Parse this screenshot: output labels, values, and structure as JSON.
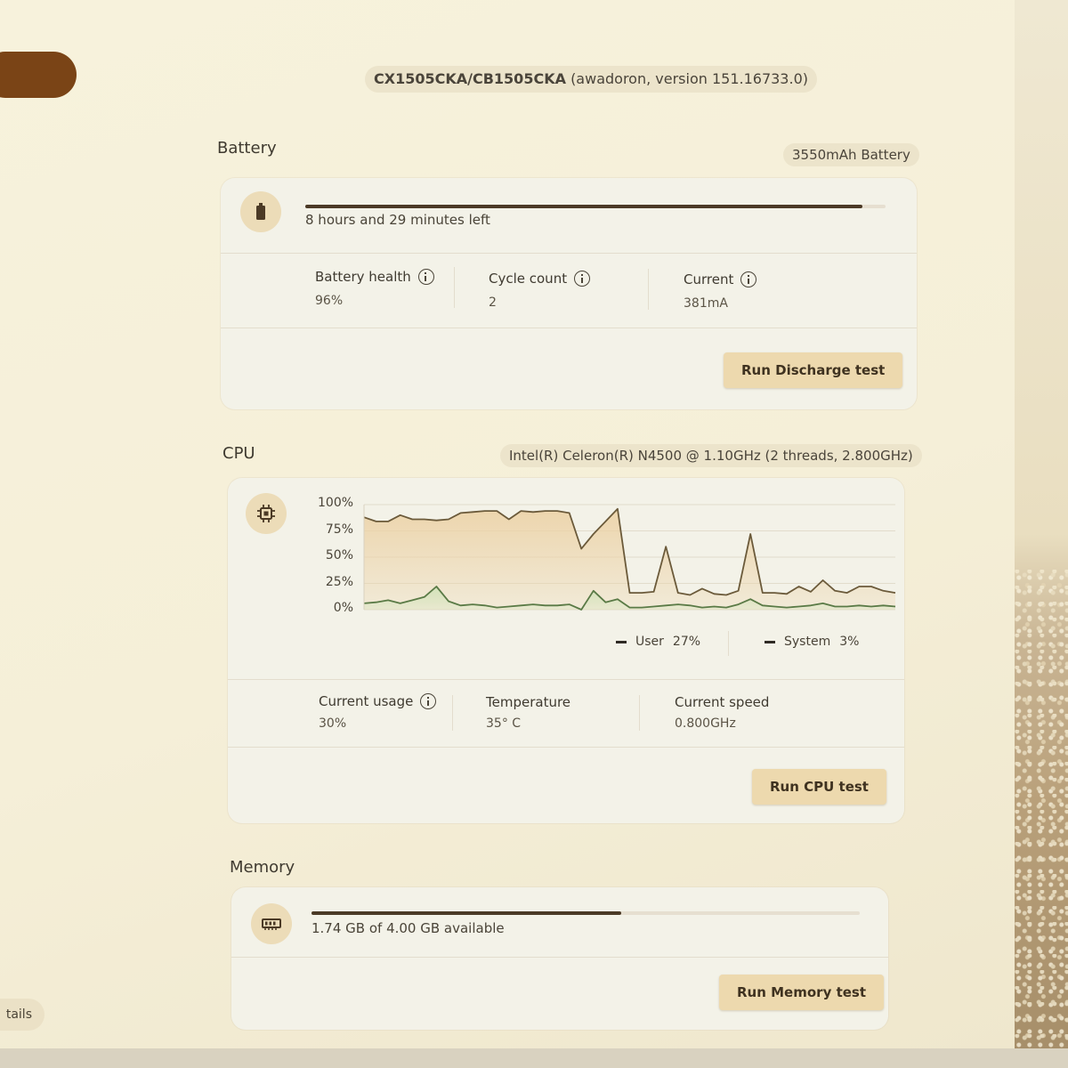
{
  "device": {
    "model": "CX1505CKA/CB1505CKA",
    "board_version": "(awadoron, version 151.16733.0)"
  },
  "side": {
    "bottom_pill_text": "tails"
  },
  "battery": {
    "title": "Battery",
    "capacity_chip": "3550mAh Battery",
    "charge_fraction": 0.96,
    "time_left": "8 hours and 29 minutes left",
    "metrics": [
      {
        "label": "Battery health",
        "value": "96%",
        "info": true
      },
      {
        "label": "Cycle count",
        "value": "2",
        "info": true
      },
      {
        "label": "Current",
        "value": "381mA",
        "info": true
      }
    ],
    "button": "Run Discharge test"
  },
  "cpu": {
    "title": "CPU",
    "model_chip": "Intel(R) Celeron(R) N4500 @ 1.10GHz (2 threads, 2.800GHz)",
    "legend": [
      {
        "name": "User",
        "value": "27%"
      },
      {
        "name": "System",
        "value": "3%"
      }
    ],
    "metrics": [
      {
        "label": "Current usage",
        "value": "30%",
        "info": true
      },
      {
        "label": "Temperature",
        "value": "35° C",
        "info": false
      },
      {
        "label": "Current speed",
        "value": "0.800GHz",
        "info": false
      }
    ],
    "button": "Run CPU test"
  },
  "chart_data": {
    "type": "area",
    "title": "",
    "xlabel": "",
    "ylabel": "",
    "ylim": [
      0,
      100
    ],
    "y_ticks": [
      "100%",
      "75%",
      "50%",
      "25%",
      "0%"
    ],
    "grid": true,
    "series": [
      {
        "name": "User",
        "color": "#6b5a3a",
        "fill": "#ecd2a6",
        "values": [
          88,
          84,
          84,
          90,
          86,
          86,
          85,
          86,
          92,
          93,
          94,
          94,
          86,
          94,
          93,
          94,
          94,
          92,
          58,
          72,
          84,
          96,
          16,
          16,
          17,
          60,
          16,
          14,
          20,
          15,
          14,
          18,
          72,
          16,
          16,
          15,
          22,
          17,
          28,
          18,
          16,
          22,
          22,
          18,
          16
        ]
      },
      {
        "name": "System",
        "color": "#5a7a46",
        "fill": "#cfe3b8",
        "values": [
          6,
          7,
          9,
          6,
          9,
          12,
          22,
          8,
          4,
          5,
          4,
          2,
          3,
          4,
          5,
          4,
          4,
          5,
          0,
          18,
          7,
          10,
          2,
          2,
          3,
          4,
          5,
          4,
          2,
          3,
          2,
          5,
          10,
          4,
          3,
          2,
          3,
          4,
          6,
          3,
          3,
          4,
          3,
          4,
          3
        ]
      }
    ]
  },
  "memory": {
    "title": "Memory",
    "available_text": "1.74 GB of 4.00 GB available",
    "used_fraction": 0.565,
    "button": "Run Memory test"
  },
  "icons": {
    "battery": "battery-icon",
    "cpu": "cpu-chip-icon",
    "memory": "memory-module-icon",
    "info": "info-icon"
  },
  "colors": {
    "accent_button": "#edd9ae",
    "icon_bg": "#ecdcb8",
    "bar_fill": "#4b3a26",
    "chip_bg": "#ece4cb"
  }
}
